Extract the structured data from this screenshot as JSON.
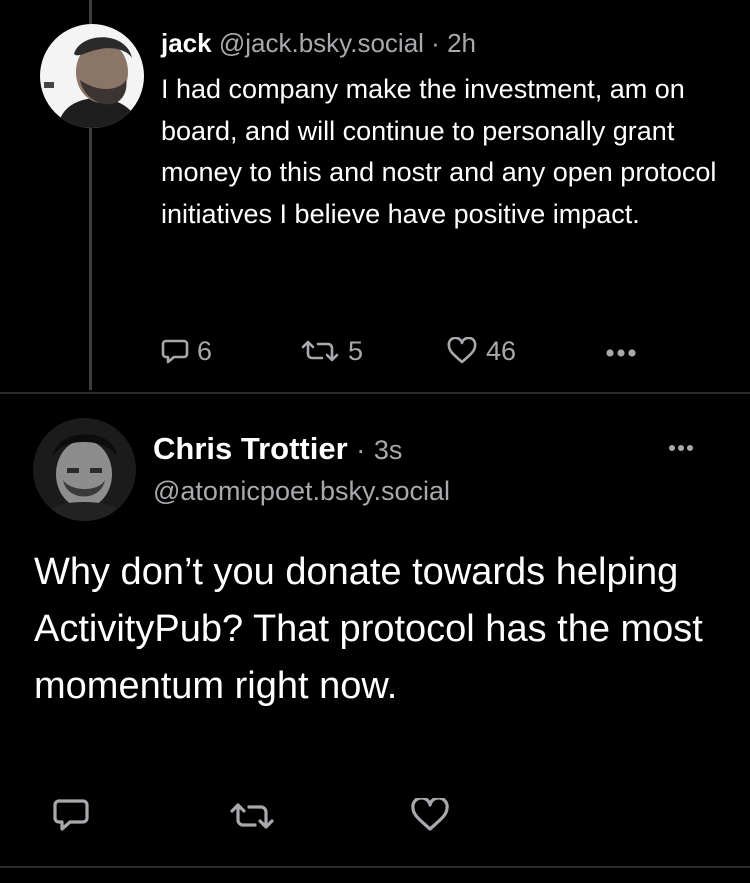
{
  "reply_post": {
    "author_name": "jack",
    "author_handle": "@jack.bsky.social",
    "separator": "·",
    "time": "2h",
    "text": "I had company make the investment, am on board, and will continue to personally grant money to this and nostr and any open protocol initiatives I believe have positive impact.",
    "reply_count": "6",
    "repost_count": "5",
    "like_count": "46"
  },
  "main_post": {
    "author_name": "Chris Trottier",
    "separator": "·",
    "time": "3s",
    "author_handle": "@atomicpoet.bsky.social",
    "text": "Why don’t you donate towards helping ActivityPub? That protocol has the most momentum right now."
  },
  "icons": {
    "reply": "reply-icon",
    "repost": "repost-icon",
    "like": "heart-icon",
    "more": "more-icon"
  },
  "colors": {
    "background": "#000000",
    "text": "#ffffff",
    "muted": "#a7a9ad",
    "divider": "#2b2b2d",
    "thread_line": "#3c3c3e"
  }
}
